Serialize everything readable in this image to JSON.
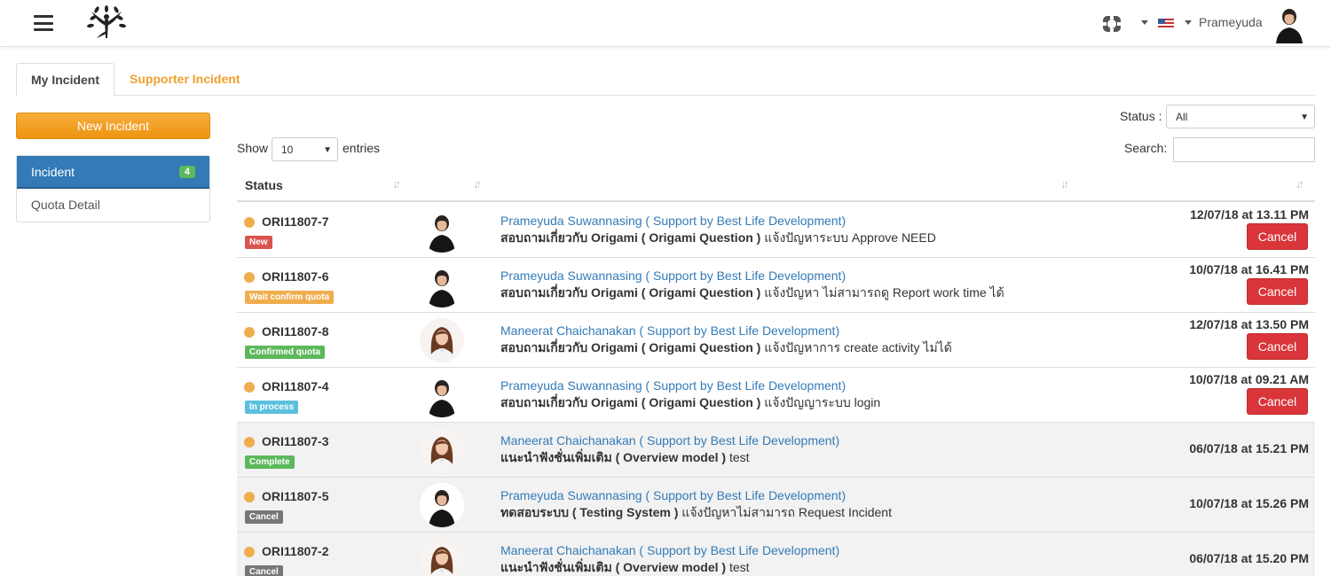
{
  "header": {
    "menu_icon": "hamburger-menu-icon",
    "logo_icon": "tree-person-logo",
    "lifebuoy_icon": "lifebuoy-icon",
    "flag_icon": "us-flag-icon",
    "username": "Prameyuda"
  },
  "tabs": [
    {
      "label": "My Incident",
      "active": true
    },
    {
      "label": "Supporter Incident",
      "active": false
    }
  ],
  "sidebar": {
    "new_button": "New Incident",
    "items": [
      {
        "label": "Incident",
        "badge": "4",
        "active": true
      },
      {
        "label": "Quota Detail",
        "active": false
      }
    ]
  },
  "controls": {
    "status_label": "Status :",
    "status_value": "All",
    "show_label": "Show",
    "entries_value": "10",
    "entries_label": "entries",
    "search_label": "Search:",
    "search_value": ""
  },
  "table": {
    "columns": [
      "Status",
      "",
      "",
      ""
    ],
    "rows": [
      {
        "code": "ORI11807-7",
        "status": "New",
        "status_color": "#d9534f",
        "avatar": "short-hair-person",
        "name": "Prameyuda Suwannasing ( Support by Best Life Development)",
        "subject_bold": "สอบถามเกี่ยวกับ Origami ( Origami Question )",
        "subject_rest": " แจ้งปัญหาระบบ Approve NEED",
        "date": "12/07/18 at 13.11 PM",
        "cancel": "Cancel"
      },
      {
        "code": "ORI11807-6",
        "status": "Wait confirm quota",
        "status_color": "#f0ad4e",
        "avatar": "short-hair-person",
        "name": "Prameyuda Suwannasing ( Support by Best Life Development)",
        "subject_bold": "สอบถามเกี่ยวกับ Origami ( Origami Question )",
        "subject_rest": " แจ้งปัญหา ไม่สามารถดู Report work time ได้",
        "date": "10/07/18 at 16.41 PM",
        "cancel": "Cancel"
      },
      {
        "code": "ORI11807-8",
        "status": "Confirmed quota",
        "status_color": "#5cb85c",
        "avatar": "long-hair-person",
        "name": "Maneerat Chaichanakan ( Support by Best Life Development)",
        "subject_bold": "สอบถามเกี่ยวกับ Origami ( Origami Question )",
        "subject_rest": " แจ้งปัญหาการ create activity ไม่ได้",
        "date": "12/07/18 at 13.50 PM",
        "cancel": "Cancel"
      },
      {
        "code": "ORI11807-4",
        "status": "In process",
        "status_color": "#5bc0de",
        "avatar": "short-hair-person",
        "name": "Prameyuda Suwannasing ( Support by Best Life Development)",
        "subject_bold": "สอบถามเกี่ยวกับ Origami ( Origami Question )",
        "subject_rest": " แจ้งปัญญาระบบ login",
        "date": "10/07/18 at 09.21 AM",
        "cancel": "Cancel"
      },
      {
        "code": "ORI11807-3",
        "status": "Complete",
        "status_color": "#5cb85c",
        "avatar": "long-hair-person",
        "name": "Maneerat Chaichanakan ( Support by Best Life Development)",
        "subject_bold": "แนะนำฟังชั่นเพิ่มเติม ( Overview model )",
        "subject_rest": " test",
        "date": "06/07/18 at 15.21 PM",
        "cancel": ""
      },
      {
        "code": "ORI11807-5",
        "status": "Cancel",
        "status_color": "#777777",
        "avatar": "short-hair-person",
        "name": "Prameyuda Suwannasing ( Support by Best Life Development)",
        "subject_bold": "ทดสอบระบบ ( Testing System )",
        "subject_rest": " แจ้งปัญหาไม่สามารถ Request Incident",
        "date": "10/07/18 at 15.26 PM",
        "cancel": ""
      },
      {
        "code": "ORI11807-2",
        "status": "Cancel",
        "status_color": "#777777",
        "avatar": "long-hair-person",
        "name": "Maneerat Chaichanakan ( Support by Best Life Development)",
        "subject_bold": "แนะนำฟังชั่นเพิ่มเติม ( Overview model )",
        "subject_rest": " test",
        "date": "06/07/18 at 15.20 PM",
        "cancel": ""
      }
    ]
  }
}
